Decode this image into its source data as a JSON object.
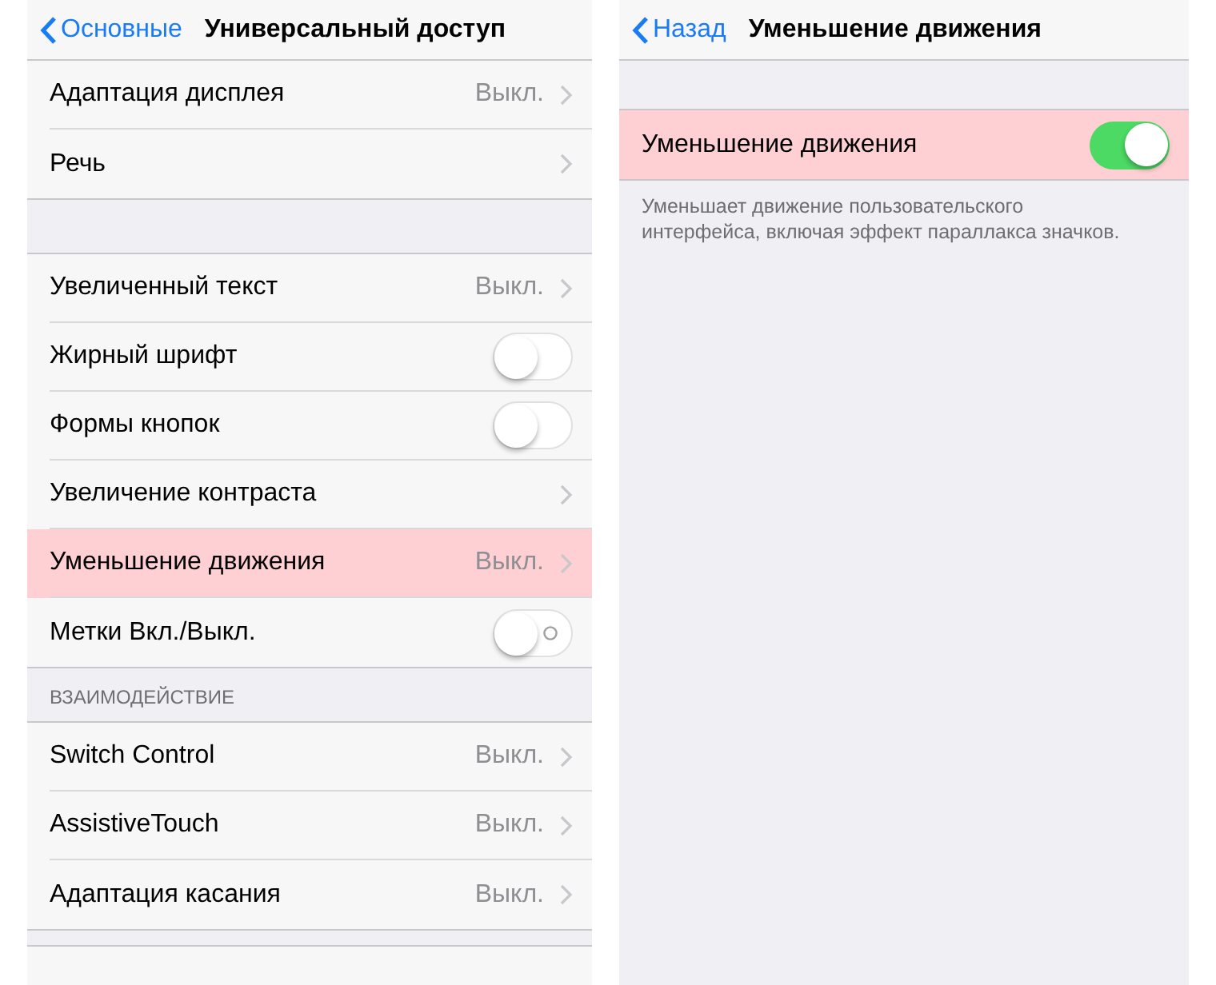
{
  "left": {
    "nav": {
      "back": "Основные",
      "title": "Универсальный доступ"
    },
    "groups": [
      {
        "rows": [
          {
            "kind": "disclosure",
            "label": "Адаптация дисплея",
            "value": "Выкл.",
            "highlighted": false
          },
          {
            "kind": "disclosure",
            "label": "Речь",
            "highlighted": false
          }
        ]
      },
      {
        "rows": [
          {
            "kind": "disclosure",
            "label": "Увеличенный текст",
            "value": "Выкл.",
            "highlighted": false
          },
          {
            "kind": "toggle",
            "label": "Жирный шрифт",
            "on": false,
            "highlighted": false
          },
          {
            "kind": "toggle",
            "label": "Формы кнопок",
            "on": false,
            "highlighted": false
          },
          {
            "kind": "disclosure",
            "label": "Увеличение контраста",
            "highlighted": false
          },
          {
            "kind": "disclosure",
            "label": "Уменьшение движения",
            "value": "Выкл.",
            "highlighted": true
          },
          {
            "kind": "toggle",
            "label": "Метки Вкл./Выкл.",
            "on": false,
            "onoff_labels": true,
            "highlighted": false
          }
        ]
      },
      {
        "header": "ВЗАИМОДЕЙСТВИЕ",
        "rows": [
          {
            "kind": "disclosure",
            "label": "Switch Control",
            "value": "Выкл.",
            "highlighted": false
          },
          {
            "kind": "disclosure",
            "label": "AssistiveTouch",
            "value": "Выкл.",
            "highlighted": false
          },
          {
            "kind": "disclosure",
            "label": "Адаптация касания",
            "value": "Выкл.",
            "highlighted": false
          }
        ]
      }
    ]
  },
  "right": {
    "nav": {
      "back": "Назад",
      "title": "Уменьшение движения"
    },
    "groups": [
      {
        "rows": [
          {
            "kind": "toggle",
            "label": "Уменьшение движения",
            "on": true,
            "highlighted": true
          }
        ],
        "footer": "Уменьшает движение пользовательского интерфейса, включая эффект параллакса значков."
      }
    ]
  }
}
